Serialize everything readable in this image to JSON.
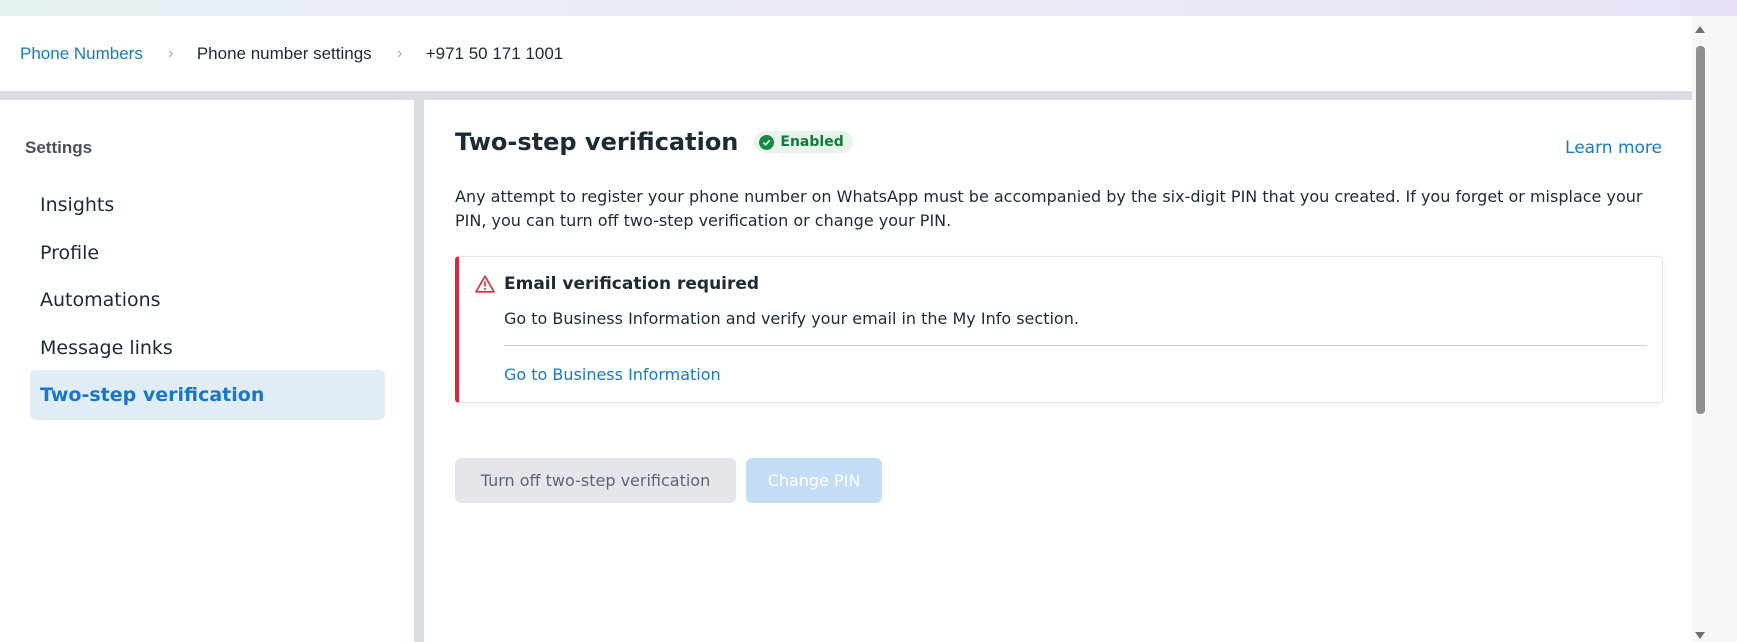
{
  "breadcrumb": {
    "items": [
      {
        "label": "Phone Numbers",
        "link": true
      },
      {
        "label": "Phone number settings",
        "link": false
      },
      {
        "label": "+971 50 171 1001",
        "link": false
      }
    ],
    "separator": "›"
  },
  "sidebar": {
    "title": "Settings",
    "items": [
      {
        "label": "Insights",
        "active": false
      },
      {
        "label": "Profile",
        "active": false
      },
      {
        "label": "Automations",
        "active": false
      },
      {
        "label": "Message links",
        "active": false
      },
      {
        "label": "Two-step verification",
        "active": true
      }
    ]
  },
  "main": {
    "title": "Two-step verification",
    "status_badge": "Enabled",
    "learn_more": "Learn more",
    "description": "Any attempt to register your phone number on WhatsApp must be accompanied by the six-digit PIN that you created. If you forget or misplace your PIN, you can turn off two-step verification or change your PIN.",
    "alert": {
      "title": "Email verification required",
      "body": "Go to Business Information and verify your email in the My Info section.",
      "link": "Go to Business Information"
    },
    "buttons": {
      "turn_off": "Turn off two-step verification",
      "change_pin": "Change PIN"
    }
  },
  "colors": {
    "accent": "#1877c9",
    "success": "#168a43",
    "danger": "#e0263b",
    "active_bg": "#e0edf7"
  },
  "icons": [
    "chevron-right-icon",
    "check-circle-icon",
    "warning-triangle-icon",
    "scroll-up-arrow-icon",
    "scroll-down-arrow-icon"
  ]
}
